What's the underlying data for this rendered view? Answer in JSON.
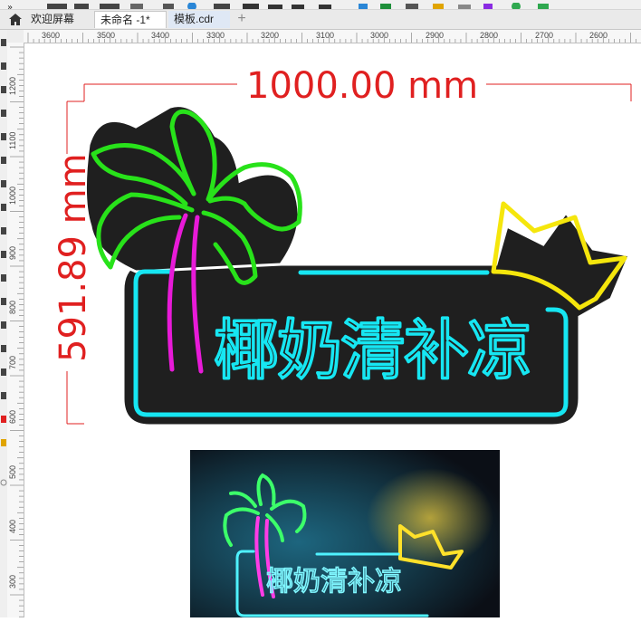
{
  "tabs": [
    {
      "label": "欢迎屏幕",
      "active": false
    },
    {
      "label": "未命名 -1*",
      "active": true
    },
    {
      "label": "模板.cdr",
      "active": false
    }
  ],
  "tab_plus": "+",
  "ruler_top_labels": [
    "3600",
    "3500",
    "3400",
    "3300",
    "3200",
    "3100",
    "3000",
    "2900",
    "2800",
    "2700",
    "2600"
  ],
  "ruler_left_labels": [
    "1200",
    "1100",
    "1000",
    "900",
    "800",
    "700",
    "600",
    "500",
    "400",
    "300"
  ],
  "dimension": {
    "width_text": "1000.00 mm",
    "height_text": "591.89 mm",
    "color": "#e02020"
  },
  "sign": {
    "text": "椰奶清补凉",
    "colors": {
      "cyan": "#16e6f2",
      "green": "#28e21a",
      "magenta": "#e81ad8",
      "yellow": "#f5e60c",
      "board": "#1f1f1f"
    }
  },
  "photo_text": "椰奶清补凉"
}
